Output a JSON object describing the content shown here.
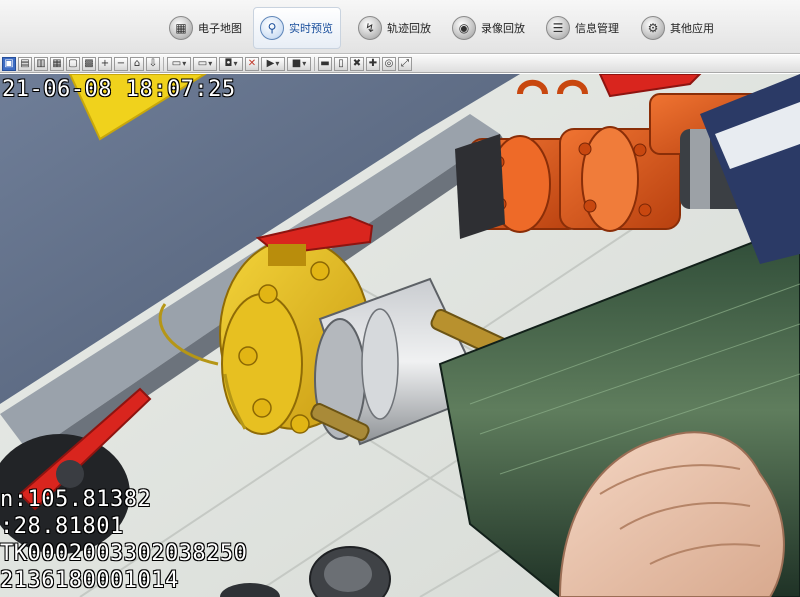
{
  "nav": {
    "items": [
      {
        "label": "电子地图",
        "icon": "map-icon"
      },
      {
        "label": "实时预览",
        "icon": "magnifier-icon",
        "active": true
      },
      {
        "label": "轨迹回放",
        "icon": "track-icon"
      },
      {
        "label": "录像回放",
        "icon": "video-replay-icon"
      },
      {
        "label": "信息管理",
        "icon": "info-management-icon"
      },
      {
        "label": "其他应用",
        "icon": "other-apps-icon"
      }
    ]
  },
  "toolbar": {
    "icons": [
      "single-view-icon",
      "multi-view-icon",
      "layout-icon",
      "grid-icon",
      "screen-icon",
      "full-grid-icon",
      "zoom-in-icon",
      "zoom-out-icon",
      "home-icon",
      "download-icon",
      "capture-dropdown-icon",
      "window-dropdown-icon",
      "camera-dropdown-icon",
      "mute-icon",
      "play-dropdown-icon",
      "stop-dropdown-icon",
      "save-icon",
      "file-icon",
      "delete-icon",
      "record-icon",
      "tape-icon",
      "fullscreen-icon"
    ]
  },
  "video": {
    "timestamp": "21-06-08 18:07:25",
    "overlay_lines": [
      "n:105.81382",
      ":28.81801",
      "TK0002003302038250",
      "2136180001014"
    ]
  },
  "colors": {
    "nav_active_text": "#1a4f9c",
    "valve_yellow": "#e9c21c",
    "valve_orange": "#e0581c",
    "handle_red": "#d9251e",
    "osd_text": "#ffffff"
  }
}
